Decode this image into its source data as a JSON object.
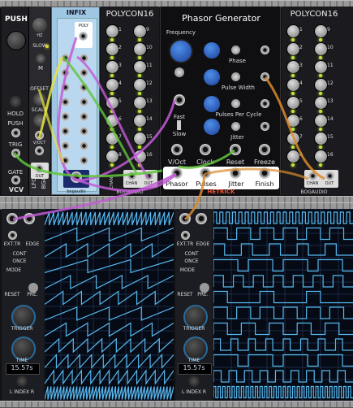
{
  "push": {
    "title": "PUSH",
    "slow": "SLOW",
    "hold": "HOLD",
    "push": "PUSH",
    "trig": "TRIG",
    "gate": "GATE",
    "brand": "VCV",
    "f_hz": "HZ",
    "m_lbl": "M",
    "offset": "OFFSET",
    "scale": "SCALE",
    "voct": "V/OCT",
    "out": "OUT",
    "lfo": "LFO",
    "bga": "BGA"
  },
  "infix": {
    "title": "INFIX",
    "poly": "POLY",
    "footer": "bogaudio"
  },
  "polycon_left": {
    "title": "POLYCON16",
    "chan": "CHAN",
    "out": "OUT",
    "brand": "BOGAUDIO",
    "nums_left": [
      "1",
      "2",
      "3",
      "4",
      "5",
      "6",
      "7",
      "8"
    ],
    "nums_right": [
      "9",
      "10",
      "11",
      "12",
      "13",
      "14",
      "15",
      "16"
    ]
  },
  "phasor": {
    "title": "Phasor Generator",
    "frequency": "Frequency",
    "phase": "Phase",
    "pulse_width": "Pulse Width",
    "pulses_per_cycle": "Pulses Per Cycle",
    "jitter": "Jitter",
    "fast": "Fast",
    "slow": "Slow",
    "voct": "V/Oct",
    "clock": "Clock",
    "reset": "Reset",
    "freeze": "Freeze",
    "out_phasor": "Phasor",
    "out_pulses": "Pulses",
    "out_jitter": "Jitter",
    "out_finish": "Finish",
    "brand": "HETRICK"
  },
  "polycon_right": {
    "title": "POLYCON16",
    "chan": "CHAN",
    "out": "OUT",
    "brand": "BOGAUDIO",
    "nums_left": [
      "1",
      "2",
      "3",
      "4",
      "5",
      "6",
      "7",
      "8"
    ],
    "nums_right": [
      "9",
      "10",
      "11",
      "12",
      "13",
      "14",
      "15",
      "16"
    ]
  },
  "scope_left": {
    "ext_tr": "EXT.TR",
    "edge": "EDGE",
    "cont": "CONT",
    "once": "ONCE",
    "mode": "MODE",
    "reset": "RESET",
    "pre": "PRE.",
    "trigger": "TRIGGER",
    "time": "TIME",
    "time_value": "15.57s",
    "index": "L INDEX R"
  },
  "scope_right": {
    "ext_tr": "EXT.TR",
    "edge": "EDGE",
    "cont": "CONT",
    "once": "ONCE",
    "mode": "MODE",
    "reset": "RESET",
    "pre": "PRE.",
    "trigger": "TRIGGER",
    "time": "TIME",
    "time_value": "15.57s",
    "index": "L INDEX R"
  },
  "colors": {
    "cable_magenta": "#c25ad6",
    "cable_green": "#5fc43a",
    "cable_orange": "#d98a2c",
    "cable_yellow": "#e6e640",
    "scope_wave": "#57b9f0",
    "infix_panel": "#9fc6e3",
    "led_green": "#bfe63a"
  }
}
